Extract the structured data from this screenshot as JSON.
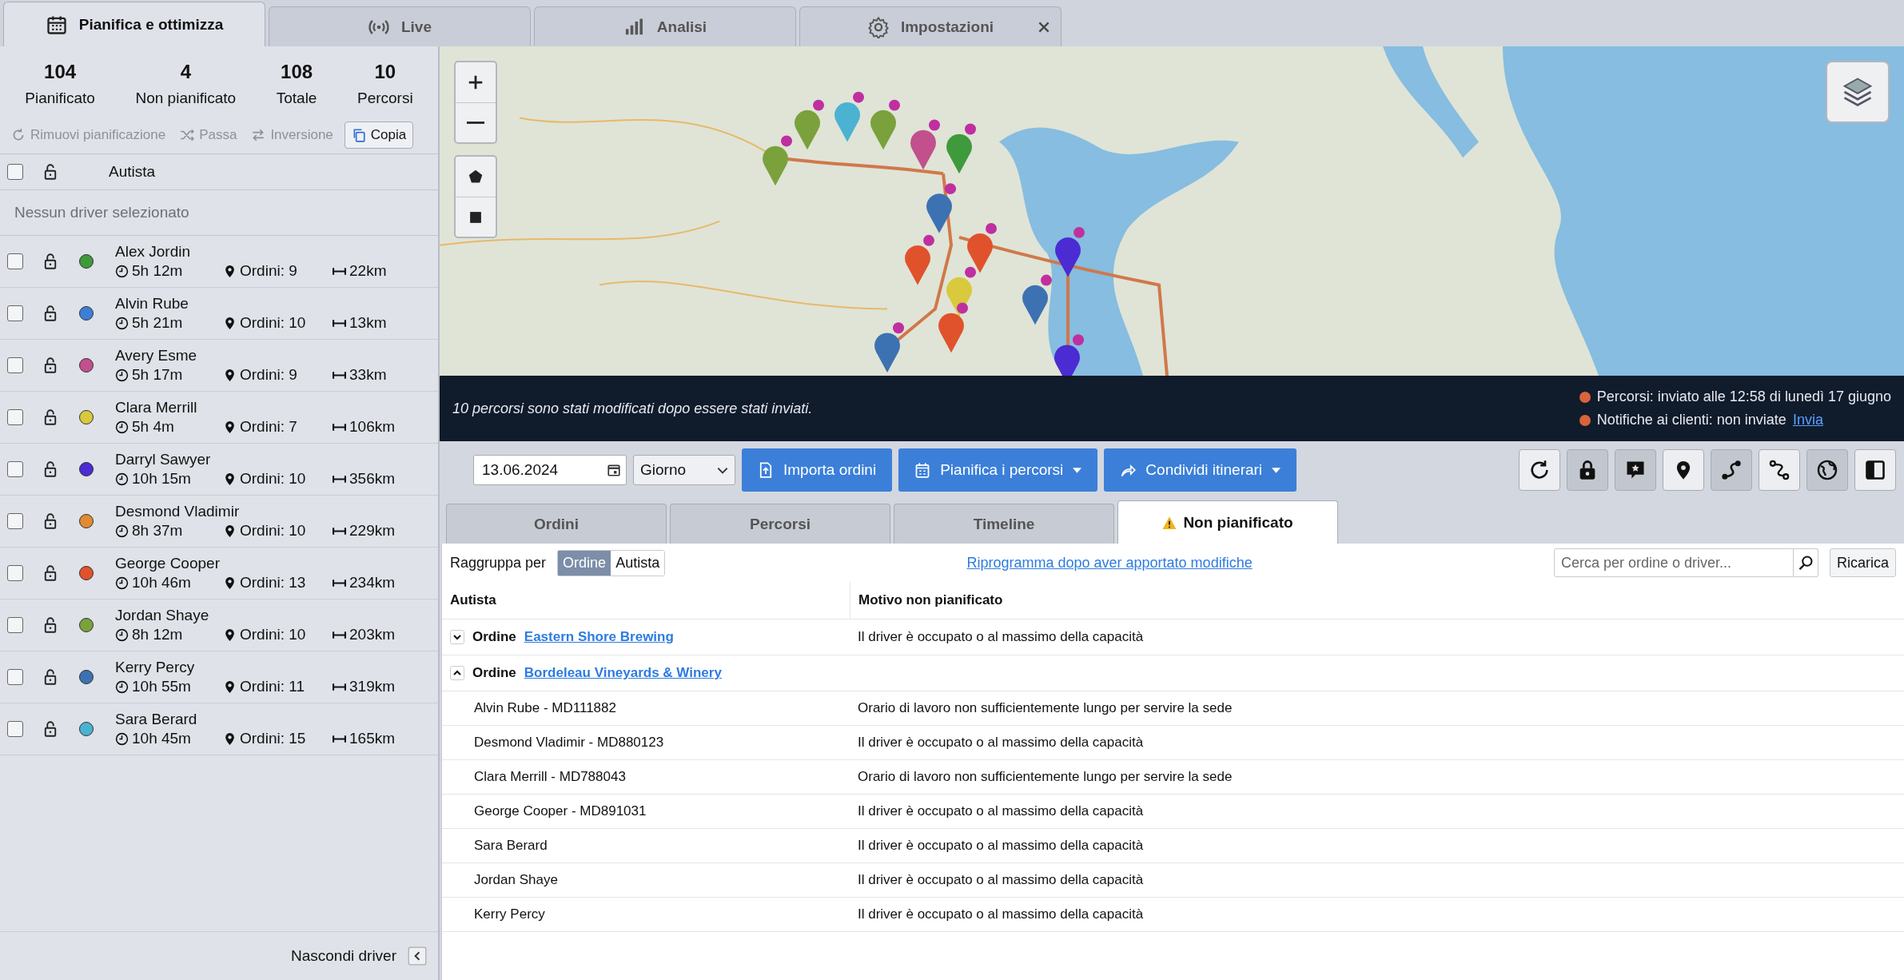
{
  "tabs": [
    {
      "label": "Pianifica e ottimizza",
      "selected": true,
      "closable": false
    },
    {
      "label": "Live",
      "selected": false,
      "closable": false
    },
    {
      "label": "Analisi",
      "selected": false,
      "closable": false
    },
    {
      "label": "Impostazioni",
      "selected": false,
      "closable": true
    }
  ],
  "stats": [
    {
      "value": "104",
      "label": "Pianificato"
    },
    {
      "value": "4",
      "label": "Non pianificato"
    },
    {
      "value": "108",
      "label": "Totale"
    },
    {
      "value": "10",
      "label": "Percorsi"
    }
  ],
  "actions": [
    {
      "label": "Rimuovi pianificazione",
      "disabled": true
    },
    {
      "label": "Passa",
      "disabled": true
    },
    {
      "label": "Inversione",
      "disabled": true
    },
    {
      "label": "Copia",
      "disabled": false
    }
  ],
  "driver_list": {
    "header": "Autista",
    "select_all_checked": false,
    "empty_message": "Nessun driver selezionato",
    "hide_label": "Nascondi driver",
    "drivers": [
      {
        "name": "Alex Jordin",
        "duration": "5h 12m",
        "orders": "Ordini: 9",
        "distance": "22km",
        "color": "#3f9a3c",
        "checked": false
      },
      {
        "name": "Alvin Rube",
        "duration": "5h 21m",
        "orders": "Ordini: 10",
        "distance": "13km",
        "color": "#3d7fd6",
        "checked": false
      },
      {
        "name": "Avery Esme",
        "duration": "5h 17m",
        "orders": "Ordini: 9",
        "distance": "33km",
        "color": "#c2508c",
        "checked": false
      },
      {
        "name": "Clara Merrill",
        "duration": "5h 4m",
        "orders": "Ordini: 7",
        "distance": "106km",
        "color": "#d9c93c",
        "checked": false
      },
      {
        "name": "Darryl Sawyer",
        "duration": "10h 15m",
        "orders": "Ordini: 10",
        "distance": "356km",
        "color": "#4b2bd2",
        "checked": false
      },
      {
        "name": "Desmond Vladimir",
        "duration": "8h 37m",
        "orders": "Ordini: 10",
        "distance": "229km",
        "color": "#e08b32",
        "checked": false
      },
      {
        "name": "George Cooper",
        "duration": "10h 46m",
        "orders": "Ordini: 13",
        "distance": "234km",
        "color": "#e0522c",
        "checked": false
      },
      {
        "name": "Jordan Shaye",
        "duration": "8h 12m",
        "orders": "Ordini: 10",
        "distance": "203km",
        "color": "#7ba13c",
        "checked": false
      },
      {
        "name": "Kerry Percy",
        "duration": "10h 55m",
        "orders": "Ordini: 11",
        "distance": "319km",
        "color": "#3c72b2",
        "checked": false
      },
      {
        "name": "Sara Berard",
        "duration": "10h 45m",
        "orders": "Ordini: 15",
        "distance": "165km",
        "color": "#4bb2d2",
        "checked": false
      }
    ]
  },
  "banner": {
    "message": "10 percorsi sono stati modificati dopo essere stati inviati.",
    "statuses": [
      {
        "text": "Percorsi: inviato alle 12:58 di lunedì 17 giugno"
      },
      {
        "text": "Notifiche ai clienti: non inviate",
        "link": "Invia"
      }
    ]
  },
  "toolbar": {
    "date": "13.06.2024",
    "period": "Giorno",
    "buttons": [
      {
        "label": "Importa ordini",
        "dropdown": false
      },
      {
        "label": "Pianifica i percorsi",
        "dropdown": true
      },
      {
        "label": "Condividi itinerari",
        "dropdown": true
      }
    ],
    "tools": [
      {
        "pressed": false
      },
      {
        "pressed": true
      },
      {
        "pressed": true
      },
      {
        "pressed": false
      },
      {
        "pressed": true
      },
      {
        "pressed": false
      },
      {
        "pressed": true
      },
      {
        "pressed": false
      }
    ]
  },
  "subtabs": [
    {
      "label": "Ordini",
      "selected": false,
      "warning": false
    },
    {
      "label": "Percorsi",
      "selected": false,
      "warning": false
    },
    {
      "label": "Timeline",
      "selected": false,
      "warning": false
    },
    {
      "label": "Non pianificato",
      "selected": true,
      "warning": true
    }
  ],
  "unplanned": {
    "group_by_label": "Raggruppa per",
    "group_options": [
      {
        "label": "Ordine",
        "selected": true
      },
      {
        "label": "Autista",
        "selected": false
      }
    ],
    "reschedule_link": "Riprogramma dopo aver apportato modifiche",
    "search_placeholder": "Cerca per ordine o driver...",
    "reload": "Ricarica",
    "columns": [
      "Autista",
      "Motivo non pianificato"
    ],
    "groups": [
      {
        "prefix": "Ordine",
        "name": "Eastern Shore Brewing",
        "expanded": false,
        "reason": "Il driver è occupato o al massimo della capacità"
      },
      {
        "prefix": "Ordine",
        "name": "Bordeleau Vineyards & Winery",
        "expanded": true,
        "rows": [
          {
            "driver": "Alvin Rube - MD111882",
            "reason": "Orario di lavoro non sufficientemente lungo per servire la sede"
          },
          {
            "driver": "Desmond Vladimir - MD880123",
            "reason": "Il driver è occupato o al massimo della capacità"
          },
          {
            "driver": "Clara Merrill - MD788043",
            "reason": "Orario di lavoro non sufficientemente lungo per servire la sede"
          },
          {
            "driver": "George Cooper - MD891031",
            "reason": "Il driver è occupato o al massimo della capacità"
          },
          {
            "driver": "Sara Berard",
            "reason": "Il driver è occupato o al massimo della capacità"
          },
          {
            "driver": "Jordan Shaye",
            "reason": "Il driver è occupato o al massimo della capacità"
          },
          {
            "driver": "Kerry Percy",
            "reason": "Il driver è occupato o al massimo della capacità"
          }
        ]
      }
    ]
  }
}
